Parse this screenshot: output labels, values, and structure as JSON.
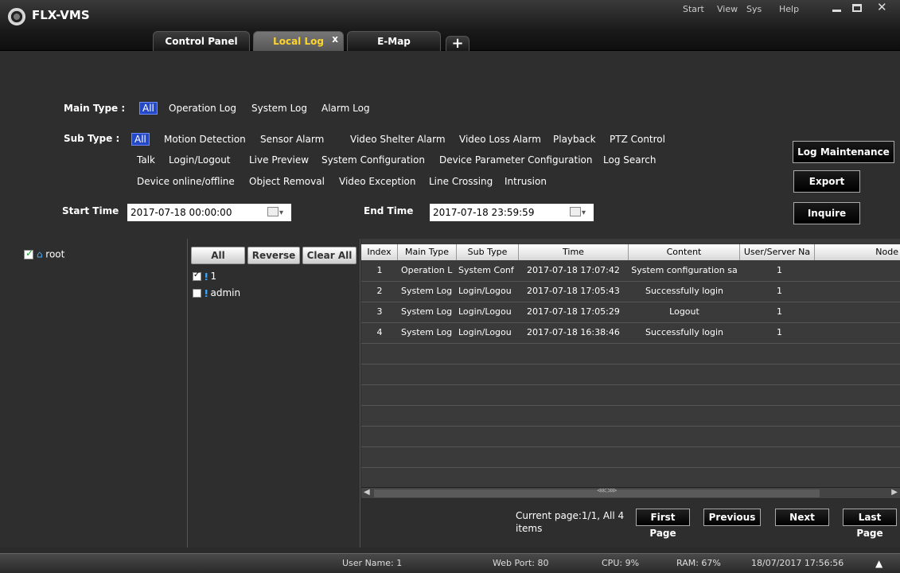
{
  "app": {
    "title": "FLX-VMS"
  },
  "tabs": [
    {
      "label": "Control Panel"
    },
    {
      "label": "Local Log",
      "close": "x"
    },
    {
      "label": "E-Map"
    },
    {
      "label": "+"
    }
  ],
  "menu": [
    "Start",
    "View",
    "Sys",
    "Help"
  ],
  "filter": {
    "main_type_label": "Main Type :",
    "main_types": [
      "All",
      "Operation Log",
      "System Log",
      "Alarm Log"
    ],
    "sub_type_label": "Sub Type :",
    "sub_types_row1": [
      "All",
      "Motion Detection",
      "Sensor Alarm",
      "Video Shelter Alarm",
      "Video Loss Alarm",
      "Playback",
      "PTZ Control"
    ],
    "sub_types_row2": [
      "Talk",
      "Login/Logout",
      "Live Preview",
      "System Configuration",
      "Device Parameter Configuration",
      "Log Search"
    ],
    "sub_types_row3": [
      "Device online/offline",
      "Object Removal",
      "Video Exception",
      "Line Crossing",
      "Intrusion"
    ],
    "start_label": "Start Time",
    "start_value": "2017-07-18 00:00:00",
    "end_label": "End Time",
    "end_value": "2017-07-18 23:59:59",
    "buttons": {
      "maintenance": "Log Maintenance",
      "export": "Export",
      "inquire": "Inquire"
    }
  },
  "tree": {
    "root": "root"
  },
  "users": {
    "buttons": [
      "All",
      "Reverse",
      "Clear All"
    ],
    "list": [
      {
        "name": "1",
        "checked": true
      },
      {
        "name": "admin",
        "checked": false
      }
    ]
  },
  "table": {
    "headers": [
      "Index",
      "Main Type",
      "Sub Type",
      "Time",
      "Content",
      "User/Server Na",
      "Node"
    ],
    "rows": [
      [
        "1",
        "Operation L",
        "System Conf",
        "2017-07-18 17:07:42",
        "System configuration sa",
        "1"
      ],
      [
        "2",
        "System Log",
        "Login/Logou",
        "2017-07-18 17:05:43",
        "Successfully login",
        "1"
      ],
      [
        "3",
        "System Log",
        "Login/Logou",
        "2017-07-18 17:05:29",
        "Logout",
        "1"
      ],
      [
        "4",
        "System Log",
        "Login/Logou",
        "2017-07-18 16:38:46",
        "Successfully login",
        "1"
      ]
    ]
  },
  "pager": {
    "info": "Current page:1/1, All 4 items",
    "first": "First Page",
    "prev": "Previous",
    "next": "Next",
    "last": "Last Page"
  },
  "status": {
    "user": "User Name: 1",
    "port": "Web Port: 80",
    "cpu": "CPU: 9%",
    "ram": "RAM: 67%",
    "datetime": "18/07/2017 17:56:56"
  }
}
